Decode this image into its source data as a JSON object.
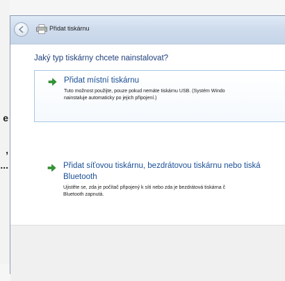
{
  "background": {
    "fragments": [
      "e",
      ",",
      "..."
    ]
  },
  "window": {
    "title": "Přidat tiskárnu",
    "back_button_icon": "back-arrow-icon",
    "title_icon": "printer-icon"
  },
  "main": {
    "heading": "Jaký typ tiskárny chcete nainstalovat?",
    "options": [
      {
        "title": "Přidat místní tiskárnu",
        "description_lines": [
          "Tuto možnost použijte, pouze pokud nemáte tiskárnu USB. (Systém Windo",
          "nainstaluje automaticky po jejich připojení.)"
        ],
        "icon": "green-arrow-icon"
      },
      {
        "title_lines": [
          "Přidat síťovou tiskárnu, bezdrátovou tiskárnu nebo tiská",
          "Bluetooth"
        ],
        "description_lines": [
          "Ujistěte se, zda je počítač připojený k síti nebo zda je bezdrátová tiskárna č",
          "Bluetooth zapnutá."
        ],
        "icon": "green-arrow-icon"
      }
    ]
  },
  "colors": {
    "heading": "#1e3f7a",
    "link": "#1a4f96",
    "arrow": "#2f9a2f"
  }
}
